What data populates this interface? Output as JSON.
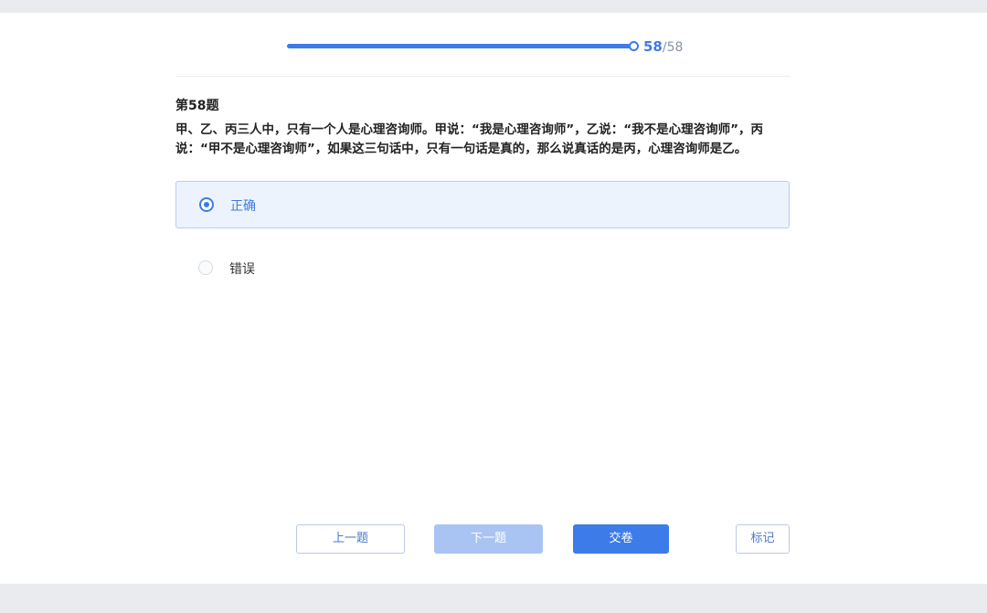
{
  "progress": {
    "current": "58",
    "total": "/58",
    "fraction": 1.0,
    "accent": "#3d7be8"
  },
  "question": {
    "title": "第58题",
    "text": "甲、乙、丙三人中，只有一个人是心理咨询师。甲说：“我是心理咨询师”，乙说：“我不是心理咨询师”，丙说：“甲不是心理咨询师”，如果这三句话中，只有一句话是真的，那么说真话的是丙，心理咨询师是乙。"
  },
  "options": [
    {
      "label": "正确",
      "selected": true
    },
    {
      "label": "错误",
      "selected": false
    }
  ],
  "buttons": {
    "prev": "上一题",
    "next": "下一题",
    "submit": "交卷",
    "mark": "标记"
  }
}
